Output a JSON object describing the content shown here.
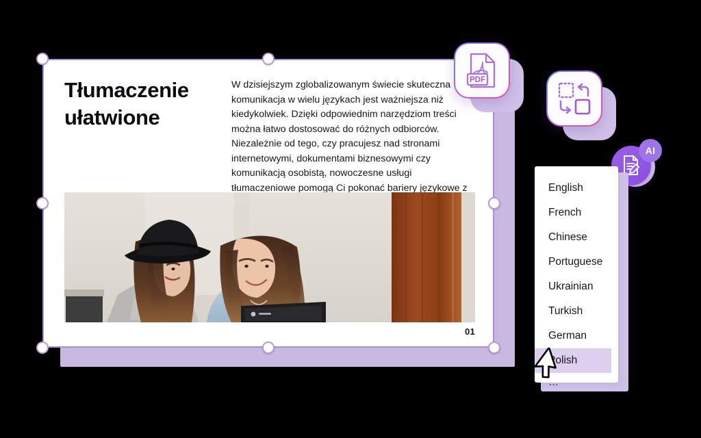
{
  "slide": {
    "title": "Tłumaczenie ułatwione",
    "body": "W dzisiejszym zglobalizowanym świecie skuteczna komunikacja w wielu językach jest ważniejsza niż kiedykolwiek. Dzięki odpowiednim narzędziom treści można łatwo dostosować do różnych odbiorców. Niezależnie od tego, czy pracujesz nad stronami internetowymi, dokumentami biznesowymi czy komunikacją osobistą, nowoczesne usługi tłumaczeniowe pomogą Ci pokonać bariery językowe z łatwością i dokładnością.",
    "page_number": "01",
    "photo_alt": "two-women-at-laptop-photo"
  },
  "icons": {
    "pdf": {
      "name": "pdf-file-icon",
      "label": "PDF"
    },
    "convert": {
      "name": "convert-format-icon"
    },
    "ai_badge": {
      "name": "ai-document-edit-icon",
      "label": "AI"
    }
  },
  "language_dropdown": {
    "items": [
      {
        "label": "English",
        "selected": false
      },
      {
        "label": "French",
        "selected": false
      },
      {
        "label": "Chinese",
        "selected": false
      },
      {
        "label": "Portuguese",
        "selected": false
      },
      {
        "label": "Ukrainian",
        "selected": false
      },
      {
        "label": "Turkish",
        "selected": false
      },
      {
        "label": "German",
        "selected": false
      },
      {
        "label": "Polish",
        "selected": true
      }
    ],
    "more_label": "…"
  },
  "colors": {
    "lavender_shadow": "#c9b8e2",
    "selection_border": "#a98fd0",
    "highlight": "#ddcfee",
    "accent_purple": "#9b5fe8",
    "gradient_start": "#5b7df5",
    "gradient_mid": "#a46ae0",
    "gradient_end": "#ef4e9b"
  }
}
